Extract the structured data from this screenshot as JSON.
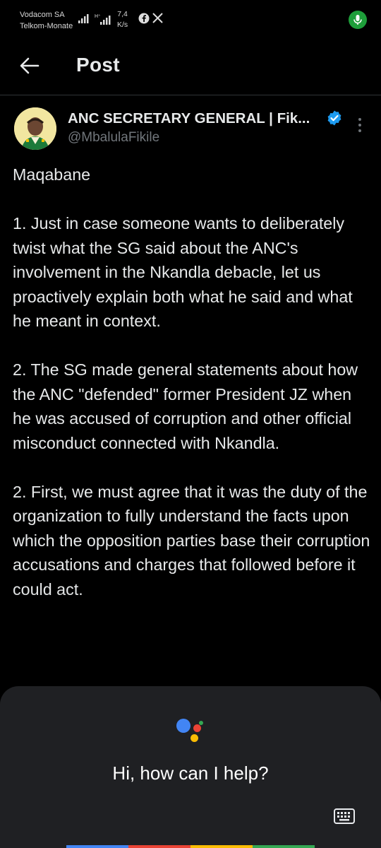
{
  "status_bar": {
    "carrier1": "Vodacom SA",
    "carrier2": "Telkom-Monate",
    "net_speed_value": "7,4",
    "net_speed_unit": "K/s",
    "icons": [
      "signal-icon",
      "facebook-icon",
      "x-icon",
      "mic-icon"
    ]
  },
  "header": {
    "title": "Post"
  },
  "post": {
    "author_name": "ANC SECRETARY GENERAL | Fik...",
    "handle": "@MbalulaFikile",
    "paragraphs": [
      "Maqabane",
      "1. Just in case someone wants to deliberately twist what the SG said about the ANC's involvement in the Nkandla debacle, let us proactively explain both what he said and what he meant in  context.",
      "2. The SG made general statements about how the ANC \"defended\" former President JZ when he was accused of corruption and other official misconduct connected with Nkandla.",
      "2. First, we must agree that it was the duty of the organization to fully understand the facts upon which the opposition parties base their corruption accusations and  charges that followed before it could act."
    ]
  },
  "assistant": {
    "prompt": "Hi, how can I help?",
    "colors": {
      "blue": "#4285f4",
      "red": "#ea4335",
      "yellow": "#fbbc04",
      "green": "#34a853"
    }
  },
  "colors": {
    "verified": "#1d9bf0",
    "mic_green": "#1e9e3a",
    "muted_text": "#71767b"
  }
}
